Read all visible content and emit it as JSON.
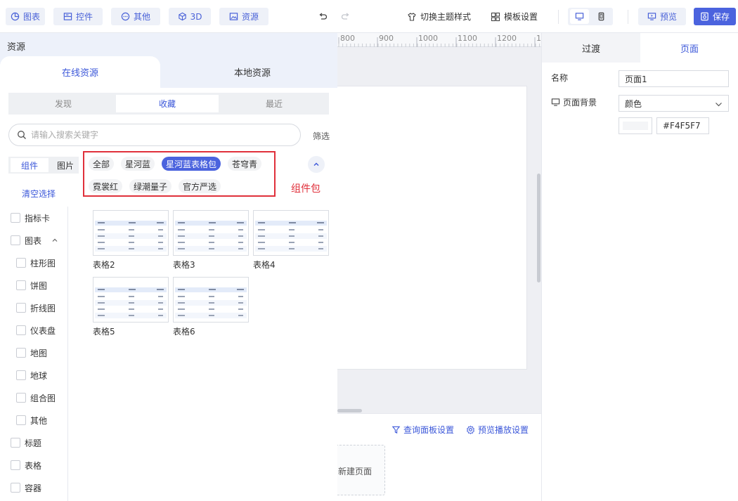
{
  "toolbar": {
    "chart": "图表",
    "control": "控件",
    "other": "其他",
    "three_d": "3D",
    "resource": "资源",
    "switch_theme": "切换主题样式",
    "template_settings": "模板设置",
    "preview": "预览",
    "save": "保存"
  },
  "ruler": {
    "ticks": [
      "800",
      "900",
      "1000",
      "1100",
      "1200",
      "1"
    ]
  },
  "panel": {
    "title": "资源",
    "tab_online": "在线资源",
    "tab_local": "本地资源",
    "seg": [
      "发现",
      "收藏",
      "最近"
    ],
    "seg_active": "收藏",
    "search_placeholder": "请输入搜索关键字",
    "filter": "筛选",
    "types": [
      "组件",
      "图片"
    ],
    "type_active": "组件",
    "packages": [
      "全部",
      "星河蓝",
      "星河蓝表格包",
      "苍穹青",
      "霓裳红",
      "绿潮量子",
      "官方严选"
    ],
    "package_active": "星河蓝表格包",
    "package_annotation": "组件包",
    "clear_selection": "清空选择",
    "tree": [
      "指标卡",
      "图表",
      "柱形图",
      "饼图",
      "折线图",
      "仪表盘",
      "地图",
      "地球",
      "组合图",
      "其他",
      "标题",
      "表格",
      "容器"
    ],
    "cards": [
      "表格2",
      "表格3",
      "表格4",
      "表格5",
      "表格6"
    ]
  },
  "canvas_bottom": {
    "query_panel": "查询面板设置",
    "preview_play": "预览播放设置",
    "new_page": "新建页面"
  },
  "props": {
    "tab_transition": "过渡",
    "tab_page": "页面",
    "name_label": "名称",
    "name_value": "页面1",
    "bg_label": "页面背景",
    "bg_type": "颜色",
    "bg_color": "#F4F5F7"
  },
  "colors": {
    "accent": "#4b63de",
    "annotation": "#e0303b"
  }
}
